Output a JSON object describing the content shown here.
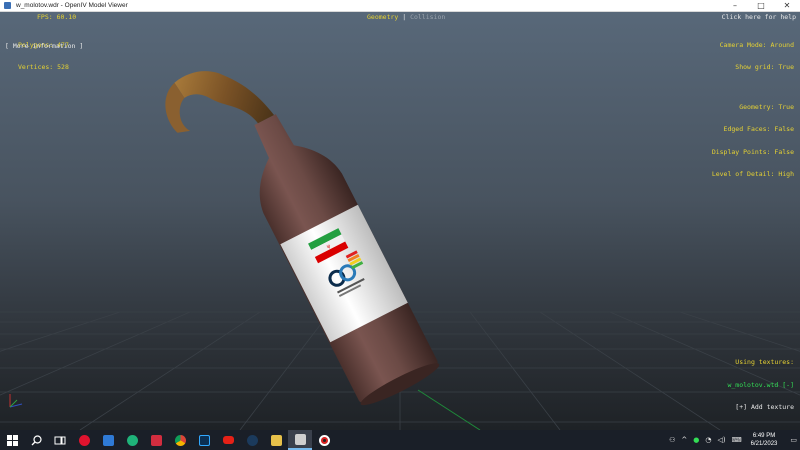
{
  "window": {
    "title": "w_molotov.wdr - OpenIV Model Viewer",
    "controls": {
      "minimize": "–",
      "maximize": "□",
      "close": "✕"
    }
  },
  "hud": {
    "fps": "FPS: 60.10",
    "polygons": "Polygons: 477",
    "vertices": "Vertices: 528",
    "more_information": "[ More information ]",
    "mode_active": "Geometry",
    "mode_separator": " | ",
    "mode_inactive": "Collision",
    "help": "Click here for help",
    "camera_mode": "Camera Mode: Around",
    "show_grid": "Show grid: True",
    "geometry": "Geometry: True",
    "edged_faces": "Edged Faces: False",
    "display_points": "Display Points: False",
    "level_of_detail": "Level of Detail: High",
    "using_textures": "Using textures:",
    "texture_file": "w_molotov.wtd [-]",
    "add_texture": "[+] Add texture"
  },
  "colors": {
    "hud_yellow": "#e6d233",
    "texture_green": "#33dd55",
    "taskbar": "#1a1f28",
    "bottle": "#6b4a45"
  },
  "taskbar": {
    "apps": [
      {
        "name": "start-icon",
        "color": "#ffffff"
      },
      {
        "name": "search-icon",
        "color": "#ffffff"
      },
      {
        "name": "task-view-icon",
        "color": "#ffffff"
      },
      {
        "name": "opera-icon",
        "color": "#e0132e"
      },
      {
        "name": "outlook-icon",
        "color": "#2f7ad6"
      },
      {
        "name": "telegram-icon",
        "color": "#1fb37a"
      },
      {
        "name": "wps-icon",
        "color": "#d22d3f"
      },
      {
        "name": "chrome-icon",
        "color": "#e8b511"
      },
      {
        "name": "photoshop-icon",
        "color": "#0b2f53"
      },
      {
        "name": "youtube-icon",
        "color": "#e62117"
      },
      {
        "name": "steam-icon",
        "color": "#1b3a5c"
      },
      {
        "name": "file-explorer-icon",
        "color": "#e6c04a"
      },
      {
        "name": "openiv-icon",
        "color": "#cfcfcf"
      },
      {
        "name": "recorder-icon",
        "color": "#e02020"
      }
    ],
    "time": "6:49 PM",
    "date": "6/21/2023"
  }
}
